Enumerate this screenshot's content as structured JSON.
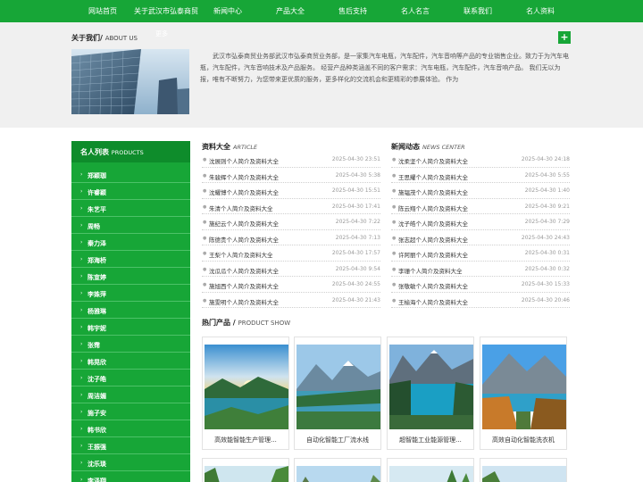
{
  "nav": {
    "items": [
      "网站首页",
      "关于武汉市弘泰商贸",
      "新闻中心",
      "产品大全",
      "售后支持",
      "名人名言",
      "联系我们",
      "名人资料"
    ]
  },
  "about": {
    "title": "关于我们/",
    "title_en": "ABOUT US",
    "ghost_label": "更多",
    "plus_label": "+",
    "text": "武汉市弘泰商贸业务部武汉市弘泰商贸业务部，是一家集汽车电瓶，汽车配件，汽车音响等产品的专业销售企业。致力于为汽车电瓶，汽车配件，汽车音响技术及产品服务。 经营产品种类涵盖不同的客户需求：汽车电瓶，汽车配件，汽车音响产品。 我们无以为报，唯有不断努力，为您带来更优质的服务，更多样化的交流机会和更精彩的参展体验。 作为"
  },
  "sidebar": {
    "title": "名人列表",
    "title_en": "PRODUCTS",
    "items": [
      "郑颖珈",
      "许睿颖",
      "朱艺平",
      "周畅",
      "秦力泽",
      "郑海桥",
      "陈宣婷",
      "李姝萍",
      "杨雅琳",
      "韩宇妮",
      "张霈",
      "韩晃欣",
      "沈子皓",
      "周洁媚",
      "施子安",
      "韩书欣",
      "王振强",
      "沈乐琰",
      "李泽翔"
    ]
  },
  "articles": {
    "title": "资料大全",
    "title_en": "ARTICLE",
    "items": [
      {
        "title": "沈展则个人简介及资料大全",
        "date": "2025-04-30 23:51"
      },
      {
        "title": "朱骏辉个人简介及资料大全",
        "date": "2025-04-30 5:38"
      },
      {
        "title": "沈耀博个人简介及资料大全",
        "date": "2025-04-30 15:51"
      },
      {
        "title": "朱清个人简介及资料大全",
        "date": "2025-04-30 17:41"
      },
      {
        "title": "施纪云个人简介及资料大全",
        "date": "2025-04-30 7:22"
      },
      {
        "title": "陈德贵个人简介及资料大全",
        "date": "2025-04-30 7:13"
      },
      {
        "title": "王梨个人简介及资料大全",
        "date": "2025-04-30 17:57"
      },
      {
        "title": "沈瓜瓜个人简介及资料大全",
        "date": "2025-04-30 9:54"
      },
      {
        "title": "施旭西个人简介及资料大全",
        "date": "2025-04-30 24:55"
      },
      {
        "title": "施雯明个人简介及资料大全",
        "date": "2025-04-30 21:43"
      }
    ]
  },
  "news": {
    "title": "新闻动态",
    "title_en": "NEWS CENTER",
    "items": [
      {
        "title": "沈柔坚个人简介及资料大全",
        "date": "2025-04-30 24:18"
      },
      {
        "title": "王思耀个人简介及资料大全",
        "date": "2025-04-30 5:55"
      },
      {
        "title": "施韫茂个人简介及资料大全",
        "date": "2025-04-30 1:40"
      },
      {
        "title": "陈云翔个人简介及资料大全",
        "date": "2025-04-30 9:21"
      },
      {
        "title": "沈子皓个人简介及资料大全",
        "date": "2025-04-30 7:29"
      },
      {
        "title": "张志超个人简介及资料大全",
        "date": "2025-04-30 24:43"
      },
      {
        "title": "许阿丽个人简介及资料大全",
        "date": "2025-04-30 0:31"
      },
      {
        "title": "李珊个人简介及资料大全",
        "date": "2025-04-30 0:32"
      },
      {
        "title": "张敬敏个人简介及资料大全",
        "date": "2025-04-30 15:33"
      },
      {
        "title": "王榆海个人简介及资料大全",
        "date": "2025-04-30 20:46"
      }
    ]
  },
  "products": {
    "title": "热门产品 /",
    "title_en": "PRODUCT SHOW",
    "items": [
      "高效能智能生产管理...",
      "自动化智能工厂流水线",
      "超智能工业能源管理...",
      "高效自动化智能洗衣机"
    ]
  },
  "colors": {
    "brand": "#17a637",
    "brand_dark": "#0e8c2b"
  }
}
